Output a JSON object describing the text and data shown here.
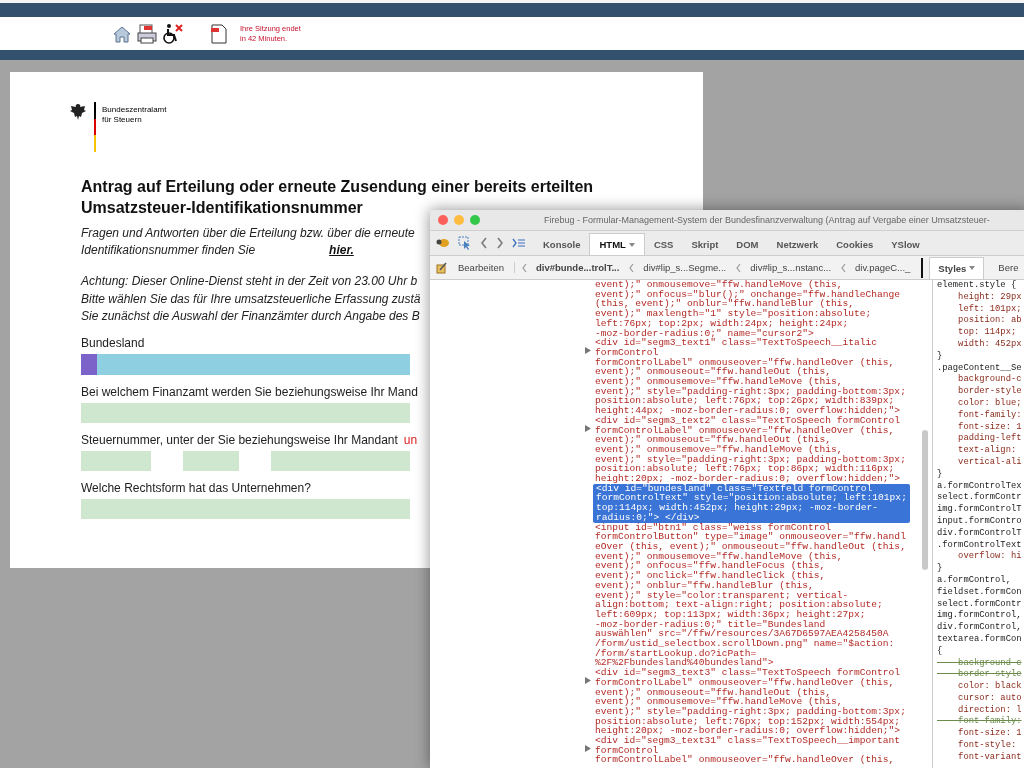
{
  "header": {
    "session_notice": "Ihre Sitzung endet\nin 42 Minuten."
  },
  "form": {
    "logo_text": "Bundeszentralamt\nfür Steuern",
    "title": "Antrag auf Erteilung oder erneute Zusendung einer bereits erteilten\nUmsatzsteuer-Identifikationsnummer",
    "intro": {
      "text": "Fragen und Antworten über die Erteilung bzw. über die erneute\nIdentifikationsnummer finden Sie",
      "link": "hier."
    },
    "notice": "Achtung: Dieser Online-Dienst steht in der Zeit von 23.00 Uhr b\nBitte wählen Sie das für Ihre umsatzsteuerliche Erfassung zustä\nSie zunächst die Auswahl der Finanzämter durch Angabe des B",
    "fields": [
      {
        "kind": "select",
        "label": "Bundesland"
      },
      {
        "kind": "text",
        "label": "Bei welchem Finanzamt werden Sie beziehungsweise Ihr Mand"
      },
      {
        "kind": "split",
        "label": "Steuernummer, unter der Sie beziehungsweise Ihr Mandant",
        "note": "un"
      },
      {
        "kind": "text",
        "label": "Welche Rechtsform hat das Unternehmen?"
      }
    ]
  },
  "firebug": {
    "title": "Firebug - Formular-Management-System der Bundesfinanzverwaltung (Antrag auf Vergabe einer Umsatzsteuer-",
    "tabs": [
      {
        "label": "Konsole",
        "selected": false
      },
      {
        "label": "HTML",
        "selected": true
      },
      {
        "label": "CSS",
        "selected": false
      },
      {
        "label": "Skript",
        "selected": false
      },
      {
        "label": "DOM",
        "selected": false
      },
      {
        "label": "Netzwerk",
        "selected": false
      },
      {
        "label": "Cookies",
        "selected": false
      },
      {
        "label": "YSlow",
        "selected": false
      }
    ],
    "edit_label": "Bearbeiten",
    "breadcrumbs": [
      {
        "label": "div#bunde...trolT...",
        "selected": true
      },
      {
        "label": "div#lip_s...Segme...",
        "selected": false
      },
      {
        "label": "div#lip_s...nstanc...",
        "selected": false
      },
      {
        "label": "div.pageC..._",
        "selected": false
      }
    ],
    "side_tabs": [
      {
        "label": "Styles",
        "selected": true
      },
      {
        "label": "Bere",
        "selected": false
      }
    ],
    "html_nodes": [
      {
        "expandable": false,
        "selected": false,
        "code": "event);\" onmousemove=\"ffw.handleMove (this,\nevent);\" onfocus=\"blur();\" onchange=\"ffw.handleChange\n(this, event);\" onblur=\"ffw.handleBlur (this,\nevent);\" maxlength=\"1\" style=\"position:absolute;\nleft:76px; top:2px; width:24px; height:24px;\n-moz-border-radius:0;\" name=\"cursor2\">"
      },
      {
        "expandable": true,
        "selected": false,
        "code": "<div id=\"segm3_text1\" class=\"TextToSpeech__italic\nformControl\nformControlLabel\" onmouseover=\"ffw.handleOver (this,\nevent);\" onmouseout=\"ffw.handleOut (this,\nevent);\" onmousemove=\"ffw.handleMove (this,\nevent);\" style=\"padding-right:3px; padding-bottom:3px;\nposition:absolute; left:76px; top:26px; width:839px;\nheight:44px; -moz-border-radius:0; overflow:hidden;\">"
      },
      {
        "expandable": true,
        "selected": false,
        "code": "<div id=\"segm3_text2\" class=\"TextToSpeech formControl\nformControlLabel\" onmouseover=\"ffw.handleOver (this,\nevent);\" onmouseout=\"ffw.handleOut (this,\nevent);\" onmousemove=\"ffw.handleMove (this,\nevent);\" style=\"padding-right:3px; padding-bottom:3px;\nposition:absolute; left:76px; top:86px; width:116px;\nheight:20px; -moz-border-radius:0; overflow:hidden;\">"
      },
      {
        "expandable": false,
        "selected": true,
        "code": "<div id=\"bundesland\" class=\"Textfeld formControl\nformControlText\" style=\"position:absolute; left:101px;\ntop:114px; width:452px; height:29px; -moz-border-\nradius:0;\"> </div>"
      },
      {
        "expandable": false,
        "selected": false,
        "code": "<input id=\"btn1\" class=\"weiss formControl\nformControlButton\" type=\"image\" onmouseover=\"ffw.handl\neOver (this, event);\" onmouseout=\"ffw.handleOut (this,\nevent);\" onmousemove=\"ffw.handleMove (this,\nevent);\" onfocus=\"ffw.handleFocus (this,\nevent);\" onclick=\"ffw.handleClick (this,\nevent);\" onblur=\"ffw.handleBlur (this,\nevent);\" style=\"color:transparent; vertical-\nalign:bottom; text-align:right; position:absolute;\nleft:609px; top:113px; width:36px; height:27px;\n-moz-border-radius:0;\" title=\"Bundesland\nauswählen\" src=\"/ffw/resources/3A67D6597AEA4258450A\n/form/ustid_selectbox.scrollDown.png\" name=\"$action:\n/form/startLookup.do?icPath=\n%2F%2Fbundesland%40bundesland\">"
      },
      {
        "expandable": true,
        "selected": false,
        "code": "<div id=\"segm3_text3\" class=\"TextToSpeech formControl\nformControlLabel\" onmouseover=\"ffw.handleOver (this,\nevent);\" onmouseout=\"ffw.handleOut (this,\nevent);\" onmousemove=\"ffw.handleMove (this,\nevent);\" style=\"padding-right:3px; padding-bottom:3px;\nposition:absolute; left:76px; top:152px; width:554px;\nheight:20px; -moz-border-radius:0; overflow:hidden;\">"
      },
      {
        "expandable": true,
        "selected": false,
        "code": "<div id=\"segm3_text31\" class=\"TextToSpeech__important\nformControl\nformControlLabel\" onmouseover=\"ffw.handleOver (this,"
      }
    ],
    "style_lines": [
      {
        "kind": "selector",
        "text": "element.style {"
      },
      {
        "kind": "prop",
        "text": "height: 29px",
        "struck": false
      },
      {
        "kind": "prop",
        "text": "left: 101px;",
        "struck": false
      },
      {
        "kind": "prop",
        "text": "position: ab",
        "struck": false
      },
      {
        "kind": "prop",
        "text": "top: 114px;",
        "struck": false
      },
      {
        "kind": "prop",
        "text": "width: 452px",
        "struck": false
      },
      {
        "kind": "brace",
        "text": "}"
      },
      {
        "kind": "selector",
        "text": ".pageContent__Se"
      },
      {
        "kind": "prop",
        "text": "background-c",
        "struck": false
      },
      {
        "kind": "prop",
        "text": "border-style",
        "struck": false
      },
      {
        "kind": "prop",
        "text": "color: blue;",
        "struck": false
      },
      {
        "kind": "prop",
        "text": "font-family:",
        "struck": false
      },
      {
        "kind": "prop",
        "text": "font-size: 1",
        "struck": false
      },
      {
        "kind": "prop",
        "text": "padding-left",
        "struck": false
      },
      {
        "kind": "prop",
        "text": "text-align:",
        "struck": false
      },
      {
        "kind": "prop",
        "text": "vertical-ali",
        "struck": false
      },
      {
        "kind": "brace",
        "text": "}"
      },
      {
        "kind": "selector",
        "text": "a.formControlTex"
      },
      {
        "kind": "selector",
        "text": "select.formContr"
      },
      {
        "kind": "selector",
        "text": "img.formControlT"
      },
      {
        "kind": "selector",
        "text": "input.formContro"
      },
      {
        "kind": "selector",
        "text": "div.formControlT"
      },
      {
        "kind": "selector",
        "text": ".formControlText"
      },
      {
        "kind": "prop",
        "text": "overflow: hi",
        "struck": false
      },
      {
        "kind": "brace",
        "text": "}"
      },
      {
        "kind": "selector",
        "text": "a.formControl,"
      },
      {
        "kind": "selector",
        "text": "fieldset.formCon"
      },
      {
        "kind": "selector",
        "text": "select.formContr"
      },
      {
        "kind": "selector",
        "text": "img.formControl,"
      },
      {
        "kind": "selector",
        "text": "div.formControl,"
      },
      {
        "kind": "selector",
        "text": "textarea.formCon"
      },
      {
        "kind": "brace",
        "text": "{"
      },
      {
        "kind": "prop",
        "text": "background-c",
        "struck": true
      },
      {
        "kind": "prop",
        "text": "border-style",
        "struck": true
      },
      {
        "kind": "prop",
        "text": "color: black",
        "struck": false
      },
      {
        "kind": "prop",
        "text": "cursor: auto",
        "struck": false
      },
      {
        "kind": "prop",
        "text": "direction: l",
        "struck": false
      },
      {
        "kind": "prop",
        "text": "font-family:",
        "struck": true
      },
      {
        "kind": "prop",
        "text": "font-size: 1",
        "struck": false
      },
      {
        "kind": "prop",
        "text": "font-style:",
        "struck": false
      },
      {
        "kind": "prop",
        "text": "font-variant",
        "struck": false
      }
    ]
  }
}
